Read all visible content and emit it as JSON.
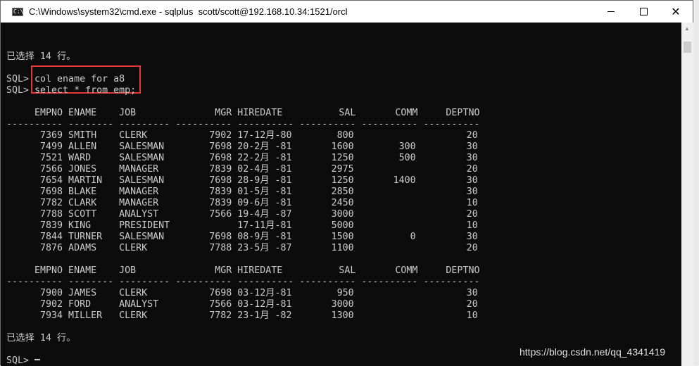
{
  "window": {
    "title": "C:\\Windows\\system32\\cmd.exe - sqlplus  scott/scott@192.168.10.34:1521/orcl",
    "icon_label": "C:\\",
    "close_glyph": "✕"
  },
  "console": {
    "lines": [
      "",
      "",
      "已选择 14 行。",
      "",
      "SQL> col ename for a8",
      "SQL> select * from emp;",
      "",
      "     EMPNO ENAME    JOB              MGR HIREDATE          SAL       COMM     DEPTNO",
      "---------- -------- --------- ---------- ---------- ---------- ---------- ----------",
      "      7369 SMITH    CLERK           7902 17-12月-80        800                    20",
      "      7499 ALLEN    SALESMAN        7698 20-2月 -81       1600        300         30",
      "      7521 WARD     SALESMAN        7698 22-2月 -81       1250        500         30",
      "      7566 JONES    MANAGER         7839 02-4月 -81       2975                    20",
      "      7654 MARTIN   SALESMAN        7698 28-9月 -81       1250       1400         30",
      "      7698 BLAKE    MANAGER         7839 01-5月 -81       2850                    30",
      "      7782 CLARK    MANAGER         7839 09-6月 -81       2450                    10",
      "      7788 SCOTT    ANALYST         7566 19-4月 -87       3000                    20",
      "      7839 KING     PRESIDENT            17-11月-81       5000                    10",
      "      7844 TURNER   SALESMAN        7698 08-9月 -81       1500          0         30",
      "      7876 ADAMS    CLERK           7788 23-5月 -87       1100                    20",
      "",
      "     EMPNO ENAME    JOB              MGR HIREDATE          SAL       COMM     DEPTNO",
      "---------- -------- --------- ---------- ---------- ---------- ---------- ----------",
      "      7900 JAMES    CLERK           7698 03-12月-81        950                    30",
      "      7902 FORD     ANALYST         7566 03-12月-81       3000                    20",
      "      7934 MILLER   CLERK           7782 23-1月 -82       1300                    10",
      "",
      "已选择 14 行。",
      "",
      "SQL> "
    ]
  },
  "watermark": "https://blog.csdn.net/qq_4341419"
}
